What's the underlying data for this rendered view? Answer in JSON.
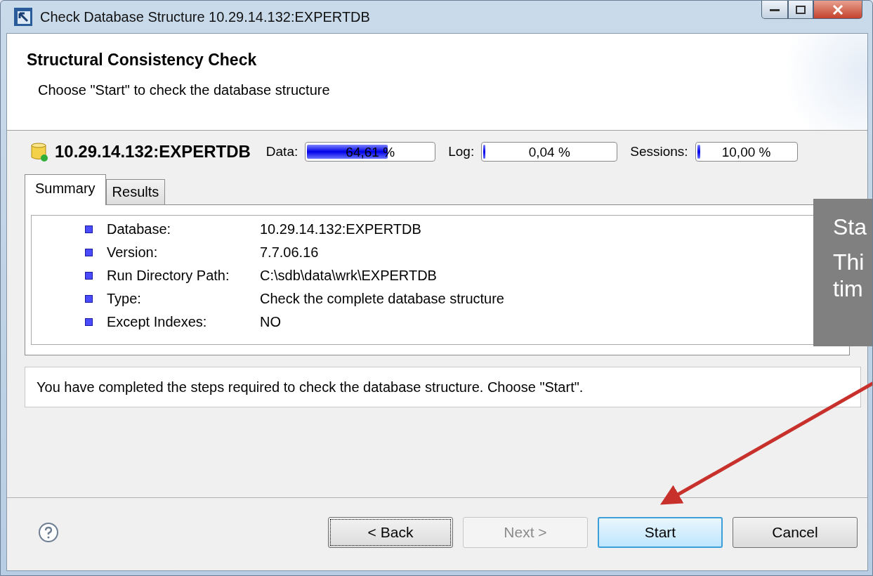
{
  "window": {
    "title": "Check Database Structure 10.29.14.132:EXPERTDB"
  },
  "header": {
    "title": "Structural Consistency Check",
    "subtitle": "Choose \"Start\" to check the database structure"
  },
  "database": {
    "name": "10.29.14.132:EXPERTDB",
    "meters": [
      {
        "label": "Data:",
        "level": 0.6461,
        "reading": "64,61 %"
      },
      {
        "label": "Log:",
        "level": 0.02,
        "reading": "0,04 %"
      },
      {
        "label": "Sessions:",
        "level": 0.06,
        "reading": "10,00 %"
      }
    ]
  },
  "tabs": [
    {
      "label": "Summary",
      "selected": true
    },
    {
      "label": "Results",
      "selected": false
    }
  ],
  "summary": [
    {
      "label": "Database:",
      "value": "10.29.14.132:EXPERTDB"
    },
    {
      "label": "Version:",
      "value": "7.7.06.16"
    },
    {
      "label": "Run Directory Path:",
      "value": "C:\\sdb\\data\\wrk\\EXPERTDB"
    },
    {
      "label": "Type:",
      "value": "Check the complete database structure"
    },
    {
      "label": "Except Indexes:",
      "value": "NO"
    }
  ],
  "message": "You have completed the steps required to check the database structure. Choose \"Start\".",
  "buttons": [
    {
      "label": "< Back",
      "disabled": false,
      "focused": true,
      "default": false
    },
    {
      "label": "Next >",
      "disabled": true,
      "focused": false,
      "default": false
    },
    {
      "label": "Start",
      "disabled": false,
      "focused": false,
      "default": true
    },
    {
      "label": "Cancel",
      "disabled": false,
      "focused": false,
      "default": false
    }
  ],
  "callout": {
    "title": "Sta",
    "lines": [
      "Thi",
      "tim"
    ]
  }
}
